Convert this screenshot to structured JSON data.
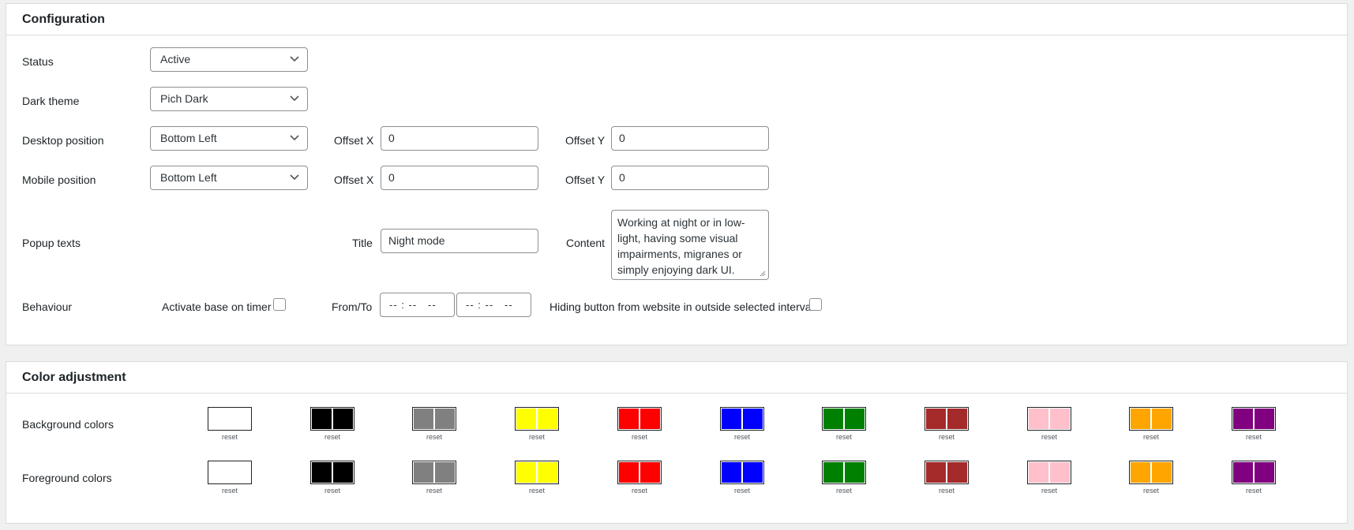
{
  "config": {
    "title": "Configuration",
    "status": {
      "label": "Status",
      "value": "Active"
    },
    "dark_theme": {
      "label": "Dark theme",
      "value": "Pich Dark"
    },
    "desktop_position": {
      "label": "Desktop position",
      "value": "Bottom Left",
      "offset_x_label": "Offset X",
      "offset_x": "0",
      "offset_y_label": "Offset Y",
      "offset_y": "0"
    },
    "mobile_position": {
      "label": "Mobile position",
      "value": "Bottom Left",
      "offset_x_label": "Offset X",
      "offset_x": "0",
      "offset_y_label": "Offset Y",
      "offset_y": "0"
    },
    "popup_texts": {
      "label": "Popup texts",
      "title_label": "Title",
      "title": "Night mode",
      "content_label": "Content",
      "content": "Working at night or in low-light, having some visual impairments, migranes or simply enjoying dark UI."
    },
    "behaviour": {
      "label": "Behaviour",
      "timer_label": "Activate base on timer",
      "from_to_label": "From/To",
      "from_placeholder": "-- : --   --",
      "to_placeholder": "-- : --   --",
      "hide_label": "Hiding button from website in outside selected interval"
    }
  },
  "colors": {
    "title": "Color adjustment",
    "background_label": "Background colors",
    "foreground_label": "Foreground colors",
    "reset_label": "reset",
    "swatches": [
      "#ffffff",
      "#000000",
      "#808080",
      "#ffff00",
      "#ff0000",
      "#0000ff",
      "#008000",
      "#a52a2a",
      "#ffc0cb",
      "#ffa500",
      "#800080"
    ]
  }
}
